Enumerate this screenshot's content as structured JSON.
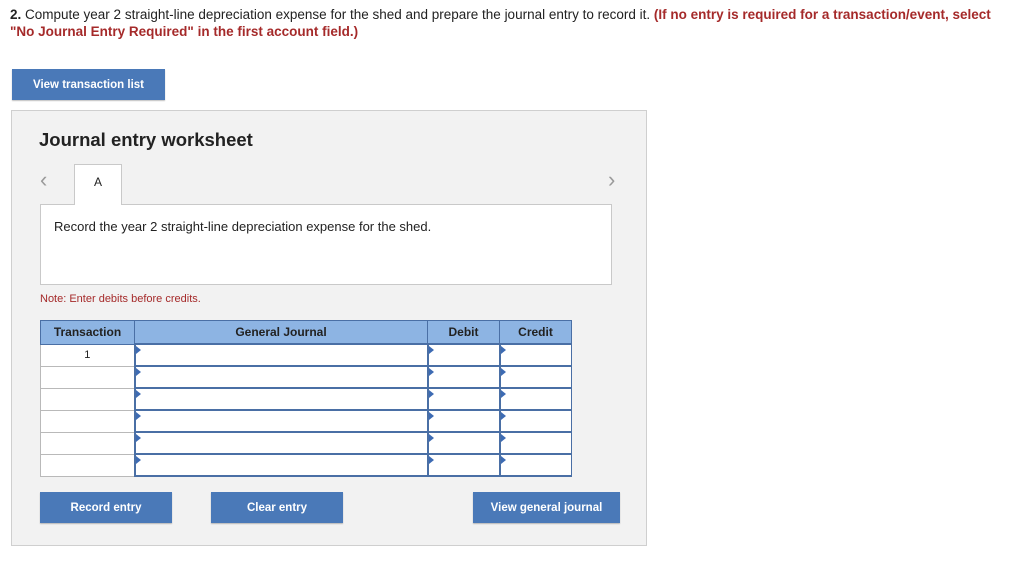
{
  "question": {
    "number": "2.",
    "text": " Compute year 2 straight-line depreciation expense for the shed and prepare the journal entry to record it. ",
    "warning": "(If no entry is required for a transaction/event, select \"No Journal Entry Required\" in the first account field.)"
  },
  "buttons": {
    "view_transaction_list": "View transaction list",
    "record_entry": "Record entry",
    "clear_entry": "Clear entry",
    "view_general_journal": "View general journal"
  },
  "worksheet": {
    "title": "Journal entry worksheet",
    "prev_icon": "chevron-left-icon",
    "next_icon": "chevron-right-icon",
    "tab_label": "A",
    "instruction": "Record the year 2 straight-line depreciation expense for the shed.",
    "note": "Note: Enter debits before credits."
  },
  "journal": {
    "headers": [
      "Transaction",
      "General Journal",
      "Debit",
      "Credit"
    ],
    "rows": [
      {
        "transaction": "1",
        "account": "",
        "debit": "",
        "credit": ""
      },
      {
        "transaction": "",
        "account": "",
        "debit": "",
        "credit": ""
      },
      {
        "transaction": "",
        "account": "",
        "debit": "",
        "credit": ""
      },
      {
        "transaction": "",
        "account": "",
        "debit": "",
        "credit": ""
      },
      {
        "transaction": "",
        "account": "",
        "debit": "",
        "credit": ""
      },
      {
        "transaction": "",
        "account": "",
        "debit": "",
        "credit": ""
      }
    ]
  },
  "colors": {
    "button": "#4a79b8",
    "header": "#8db4e3",
    "warning": "#a52a2a",
    "panel": "#f2f2f2"
  }
}
